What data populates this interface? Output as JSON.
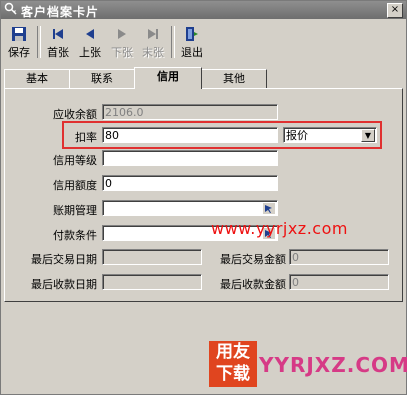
{
  "window": {
    "title": "客户档案卡片",
    "close_glyph": "×"
  },
  "toolbar": [
    {
      "key": "save",
      "label": "保存",
      "icon": "floppy-disk-icon",
      "enabled": true
    },
    {
      "key": "first",
      "label": "首张",
      "icon": "first-record-icon",
      "enabled": true
    },
    {
      "key": "prev",
      "label": "上张",
      "icon": "previous-record-icon",
      "enabled": true
    },
    {
      "key": "next",
      "label": "下张",
      "icon": "next-record-icon",
      "enabled": false
    },
    {
      "key": "last",
      "label": "末张",
      "icon": "last-record-icon",
      "enabled": false
    },
    {
      "key": "exit",
      "label": "退出",
      "icon": "exit-door-icon",
      "enabled": true
    }
  ],
  "tabs": [
    {
      "label": "基本",
      "active": false
    },
    {
      "label": "联系",
      "active": false
    },
    {
      "label": "信用",
      "active": true
    },
    {
      "label": "其他",
      "active": false
    }
  ],
  "form": {
    "receivable_balance": {
      "label": "应收余额",
      "value": "2106.0"
    },
    "discount_rate": {
      "label": "扣率",
      "value": "80",
      "price_type": "报价"
    },
    "credit_grade": {
      "label": "信用等级",
      "value": ""
    },
    "credit_limit": {
      "label": "信用额度",
      "value": "0"
    },
    "payment_term": {
      "label": "账期管理",
      "value": ""
    },
    "payment_condition": {
      "label": "付款条件",
      "value": ""
    },
    "last_trade_date": {
      "label": "最后交易日期",
      "value": ""
    },
    "last_trade_amount": {
      "label": "最后交易金额",
      "value": "0"
    },
    "last_receipt_date": {
      "label": "最后收款日期",
      "value": ""
    },
    "last_receipt_amount": {
      "label": "最后收款金额",
      "value": "0"
    }
  },
  "watermark": {
    "url": "www.yyrjxz.com",
    "logo_line1": "用友",
    "logo_line2": "下载",
    "logo_text": "YYRJXZ.COM"
  },
  "colors": {
    "highlight": "#e03030",
    "watermark": "#e11111",
    "logo_bg": "#e0451f",
    "logo_text": "#d63a86"
  }
}
